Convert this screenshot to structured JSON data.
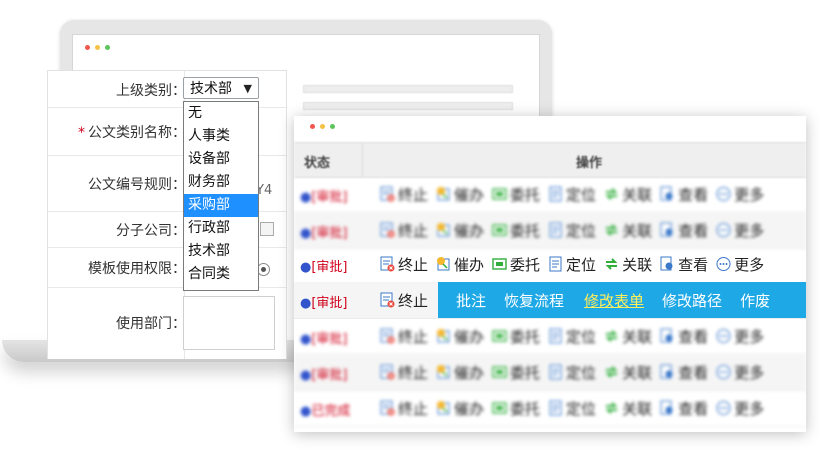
{
  "form": {
    "parent_category_label": "上级类别：",
    "category_name_label": "公文类别名称：",
    "required_mark": "*",
    "number_rule_label": "公文编号规则：",
    "subsidiary_label": "分子公司：",
    "template_permission_label": "模板使用权限：",
    "department_label": "使用部门：",
    "selected_value": "技术部",
    "partial_text": "Y4",
    "options": [
      "无",
      "人事类",
      "设备部",
      "财务部",
      "采购部",
      "行政部",
      "技术部",
      "合同类"
    ],
    "highlighted_option": "采购部"
  },
  "table": {
    "status_header": "状态",
    "action_header": "操作",
    "row_status": "[审批]",
    "last_status": "已完成",
    "actions": [
      {
        "icon": "stop-icon",
        "label": "终止"
      },
      {
        "icon": "urge-icon",
        "label": "催办"
      },
      {
        "icon": "delegate-icon",
        "label": "委托"
      },
      {
        "icon": "locate-icon",
        "label": "定位"
      },
      {
        "icon": "link-icon",
        "label": "关联"
      },
      {
        "icon": "view-icon",
        "label": "查看"
      },
      {
        "icon": "more-icon",
        "label": "更多"
      }
    ],
    "more_menu": [
      "批注",
      "恢复流程",
      "修改表单",
      "修改路径",
      "作废"
    ],
    "more_menu_active": "修改表单"
  },
  "colors": {
    "accent_blue": "#1fa8e6",
    "selected_blue": "#1e90ff",
    "status_red": "#d0021b",
    "link_green": "#2fae3a"
  }
}
